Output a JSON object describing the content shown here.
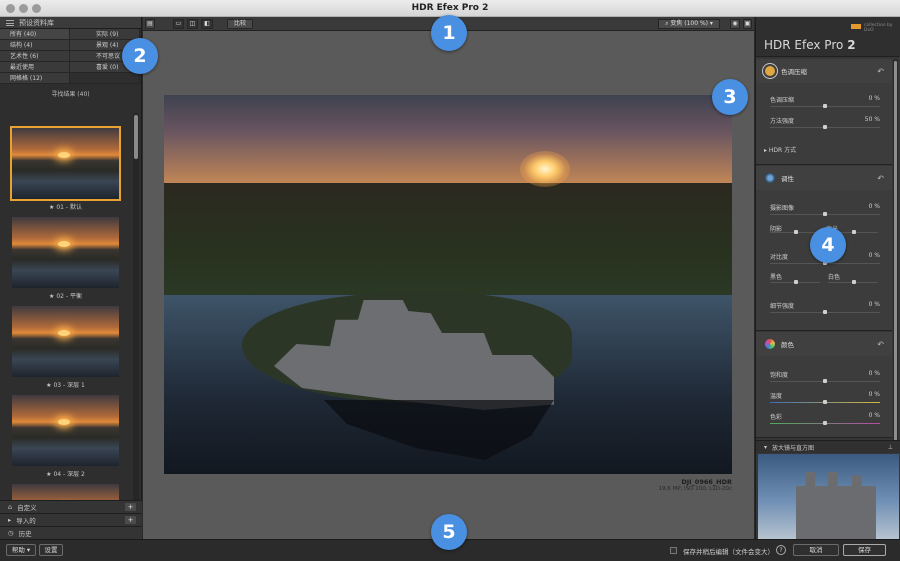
{
  "app": {
    "title": "HDR Efex Pro 2"
  },
  "markers": [
    "1",
    "2",
    "3",
    "4",
    "5"
  ],
  "left_panel": {
    "header": "预设资料库",
    "categories": [
      {
        "label": "所有 (40)",
        "active": true
      },
      {
        "label": "实际 (9)"
      },
      {
        "label": "结构 (4)"
      },
      {
        "label": "景观 (4)"
      },
      {
        "label": "艺术性 (6)"
      },
      {
        "label": "不可思议 (5)"
      },
      {
        "label": "最近使用"
      },
      {
        "label": "喜爱 (0)"
      },
      {
        "label": "网格格 (12)"
      }
    ],
    "find_label": "寻找结果 (40)",
    "presets": [
      {
        "label": "★ 01 - 默认",
        "selected": true
      },
      {
        "label": "★ 02 - 平衡"
      },
      {
        "label": "★ 03 - 深层 1"
      },
      {
        "label": "★ 04 - 深层 2"
      }
    ],
    "sections": [
      {
        "label": "自定义"
      },
      {
        "label": "导入的"
      },
      {
        "label": "历史"
      }
    ]
  },
  "toolbar": {
    "compare_label": "比较",
    "zoom_label": "变焦 (100 %)"
  },
  "image": {
    "filename": "DJI_0966_HDR",
    "meta": "19,6 MP, ISO 100, L1D-20c"
  },
  "right_panel": {
    "product": "HDR Efex Pro",
    "version": "2",
    "brand_small": "collection by DxO",
    "tone": {
      "title": "色调压缩",
      "rows": [
        {
          "label": "色调压缩",
          "value": "0 %"
        },
        {
          "label": "方法强度",
          "value": "50 %"
        }
      ],
      "hdr_method": "HDR 方式"
    },
    "tonality": {
      "title": "调性",
      "exposure": {
        "label": "摄影图像",
        "value": "0 %"
      },
      "shadows": "阴影",
      "highlights": "高光",
      "contrast": {
        "label": "对比度",
        "value": "0 %"
      },
      "blacks": "黑色",
      "whites": "白色",
      "detail": {
        "label": "细节强度",
        "value": "0 %"
      }
    },
    "color": {
      "title": "颜色",
      "saturation": {
        "label": "饱和度",
        "value": "0 %"
      },
      "temperature": {
        "label": "温度",
        "value": "0 %"
      },
      "tint": {
        "label": "色彩",
        "value": "0 %"
      }
    },
    "loupe_title": "放大镜与直方图"
  },
  "bottom": {
    "help": "帮助",
    "settings": "设置",
    "save_option": "保存并稍后编辑（文件会变大）",
    "cancel": "取消",
    "save": "保存"
  }
}
